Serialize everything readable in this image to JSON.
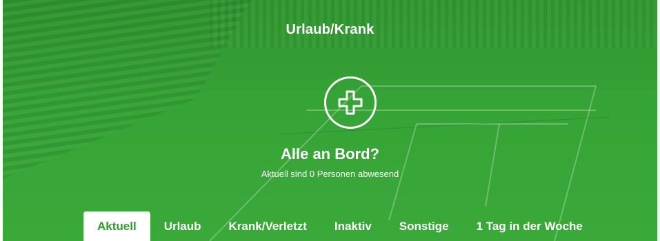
{
  "header": {
    "title": "Urlaub/Krank",
    "icon": "plus-circle-icon"
  },
  "status": {
    "headline": "Alle an Bord?",
    "subline": "Aktuell sind 0 Personen abwesend"
  },
  "tabs": [
    {
      "label": "Aktuell",
      "active": true
    },
    {
      "label": "Urlaub",
      "active": false
    },
    {
      "label": "Krank/Verletzt",
      "active": false
    },
    {
      "label": "Inaktiv",
      "active": false
    },
    {
      "label": "Sonstige",
      "active": false
    },
    {
      "label": "1 Tag in der Woche",
      "active": false
    }
  ],
  "colors": {
    "accent": "#2f9a2f",
    "text": "#ffffff",
    "tab_active_bg": "#ffffff"
  }
}
